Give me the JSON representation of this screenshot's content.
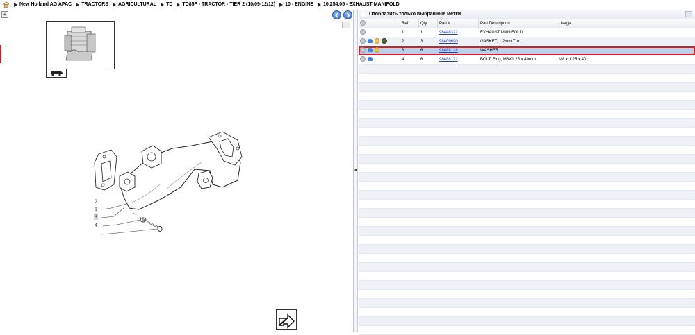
{
  "breadcrumb": {
    "home_icon": "home-icon",
    "items": [
      "New Holland AG APAC",
      "TRACTORS",
      "AGRICULTURAL",
      "TD",
      "TD85F - TRACTOR - TIER 2 (10/09-12/12)",
      "10 - ENGINE",
      "10.254.05 - EXHAUST MANIFOLD"
    ]
  },
  "toolbar": {
    "expand_label": "+",
    "prev_icon": "arrow-left-circle-icon",
    "next_icon": "arrow-right-circle-icon"
  },
  "drawing": {
    "callouts": [
      "2",
      "1",
      "3",
      "4"
    ],
    "selected_callout": "3"
  },
  "filter": {
    "label": "Отобразить только выбранные метки",
    "checked": false
  },
  "table": {
    "headers": {
      "ref": "Ref",
      "qty": "Qty",
      "part": "Part #",
      "desc": "Part Description",
      "usage": "Usage"
    },
    "rows": [
      {
        "ref": "1",
        "qty": "1",
        "part": "98448322",
        "desc": "EXHAUST MANIFOLD",
        "usage": "",
        "icons": [
          "gear-icon"
        ]
      },
      {
        "ref": "2",
        "qty": "3",
        "part": "98409690",
        "desc": "GASKET, 1.2mm Thk",
        "usage": "",
        "icons": [
          "gear-icon",
          "hand-icon",
          "lightbulb-icon",
          "globe-icon"
        ]
      },
      {
        "ref": "3",
        "qty": "6",
        "part": "98488128",
        "desc": "WASHER",
        "usage": "",
        "icons": [
          "gear-icon",
          "hand-icon",
          "lightbulb-icon"
        ],
        "selected": true
      },
      {
        "ref": "4",
        "qty": "6",
        "part": "98488122",
        "desc": "BOLT, Flng, M8X1.25 x 40mm",
        "usage": "M8 x 1.25 x 40",
        "icons": [
          "gear-icon",
          "hand-icon"
        ]
      }
    ]
  },
  "colors": {
    "selection_border": "#d61f1f",
    "selection_fill": "#bcd0ea",
    "link": "#1d3fb7",
    "nav_button": "#2e6ac8"
  }
}
